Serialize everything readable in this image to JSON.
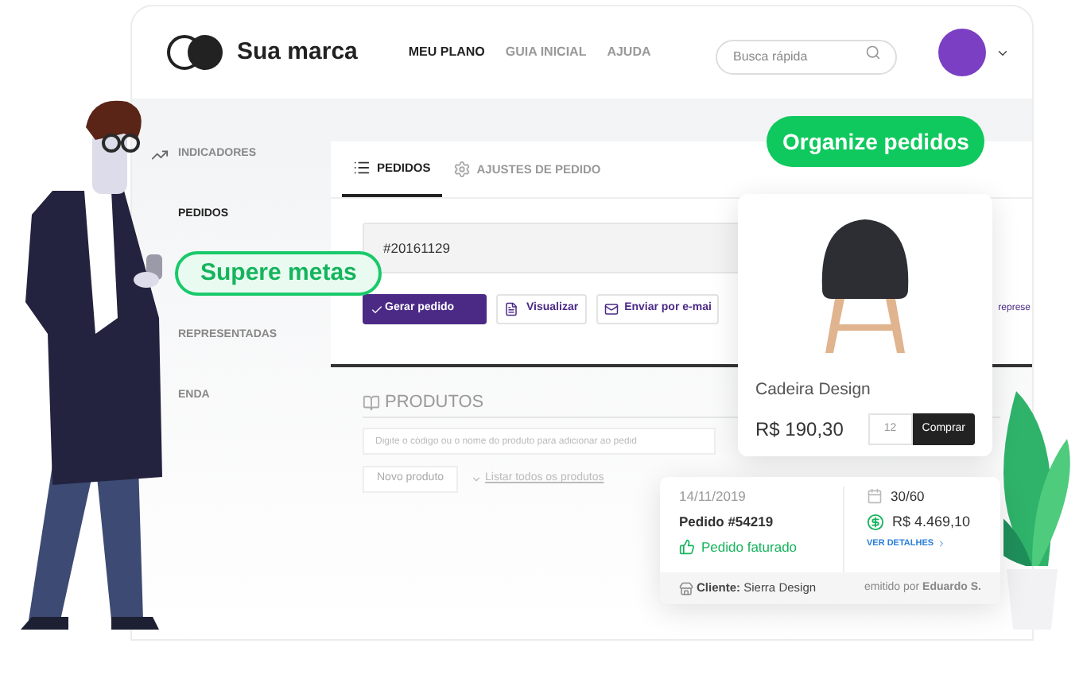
{
  "brand": {
    "name": "Sua marca"
  },
  "nav": [
    {
      "label": "MEU PLANO",
      "selected": true
    },
    {
      "label": "GUIA INICIAL",
      "selected": false
    },
    {
      "label": "AJUDA",
      "selected": false
    }
  ],
  "search": {
    "placeholder": "Busca rápida"
  },
  "sidebar": {
    "items": [
      {
        "label": "INDICADORES",
        "kind": "trend",
        "selected": false
      },
      {
        "label": "PEDIDOS",
        "kind": "plain",
        "selected": true
      },
      {
        "label": "REPRESENTADAS",
        "kind": "plain",
        "selected": false
      },
      {
        "label": "ENDA",
        "kind": "plain",
        "selected": false
      }
    ]
  },
  "tabs": [
    {
      "label": "PEDIDOS",
      "kind": "list",
      "selected": true
    },
    {
      "label": "AJUSTES DE PEDIDO",
      "kind": "gear",
      "selected": false
    }
  ],
  "order": {
    "number": "#20161129"
  },
  "actions": [
    {
      "label": "Gerar pedido",
      "kind": "primary"
    },
    {
      "label": "Visualizar",
      "kind": "document"
    },
    {
      "label": "Enviar por e-mai",
      "kind": "mail"
    },
    {
      "label": "represe",
      "kind": "link"
    }
  ],
  "products": {
    "title": "PRODUTOS",
    "search_placeholder": "Digite o código ou o nome do produto para adicionar ao pedid",
    "new_button": "Novo produto",
    "list_link": "Listar todos os produtos"
  },
  "callouts": [
    {
      "text": "Supere metas",
      "kind": "outline"
    },
    {
      "text": "Organize pedidos",
      "kind": "solid"
    }
  ],
  "product_card": {
    "name": "Cadeira Design",
    "price": "R$ 190,30",
    "quantity": "12",
    "buy_button": "Comprar"
  },
  "order_card": {
    "date": "14/11/2019",
    "title": "Pedido #54219",
    "status": "Pedido faturado",
    "installments": "30/60",
    "total": "R$ 4.469,10",
    "details_link": "VER DETALHES",
    "client": "**Cliente:** Sierra Design",
    "issued_by": "emitido por **Eduardo S.**"
  }
}
